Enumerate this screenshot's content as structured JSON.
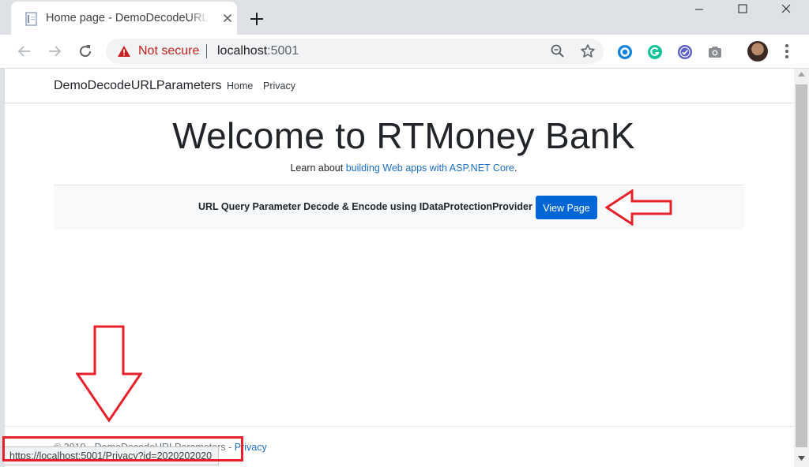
{
  "browser": {
    "tab_title": "Home page - DemoDecodeURLParameters",
    "new_tab_label": "+",
    "security_label": "Not secure",
    "url_host": "localhost",
    "url_port": ":5001",
    "extensions": [
      "opera-icon",
      "grammarly-icon",
      "check-extension-icon",
      "camera-icon"
    ],
    "status_url": "https://localhost:5001/Privacy?id=2020202020"
  },
  "site": {
    "brand": "DemoDecodeURLParameters",
    "nav": [
      {
        "label": "Home"
      },
      {
        "label": "Privacy"
      }
    ],
    "hero_title": "Welcome to RTMoney BanK",
    "learn_prefix": "Learn about ",
    "learn_link": "building Web apps with ASP.NET Core",
    "learn_suffix": ".",
    "panel_text": "URL Query Parameter Decode & Encode using IDataProtectionProvider",
    "view_button": "View Page",
    "footer_text": "© 2019 - DemoDecodeURLParameters - ",
    "footer_link": "Privacy"
  },
  "colors": {
    "accent_button": "#0366d6",
    "link": "#1b6ec2",
    "annotation": "#e8202a",
    "warning": "#c5221f"
  }
}
